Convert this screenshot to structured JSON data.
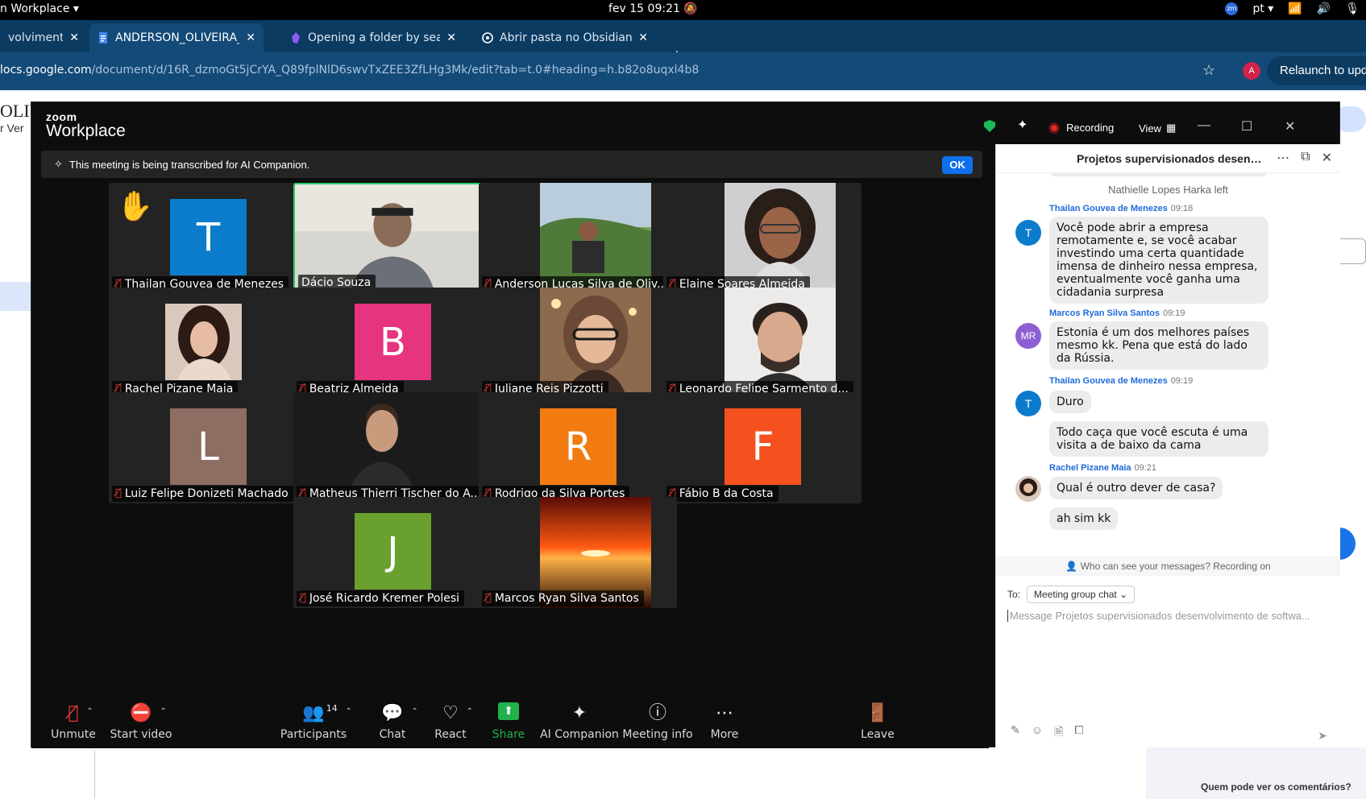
{
  "os": {
    "activities": "n Workplace ▾",
    "clock": "fev 15  09:21",
    "lang": "pt ▾",
    "zm": "zm"
  },
  "browser": {
    "tabs": [
      {
        "label": "volvimento",
        "active": false
      },
      {
        "label": "ANDERSON_OLIVEIRA_E",
        "active": true
      },
      {
        "label": "Opening a folder by sear",
        "active": false
      },
      {
        "label": "Abrir pasta no Obsidian",
        "active": false
      }
    ],
    "url_host": "locs.google.com",
    "url_path": "/document/d/16R_dzmoGt5jCrYA_Q89fplNlD6swvTxZEE3ZfLHg3Mk/edit?tab=t.0#heading=h.b82o8uqxl4b8",
    "profile_initial": "A",
    "relaunch": "Relaunch to upd"
  },
  "docs": {
    "title": "OLIV",
    "menu": "r  Ver",
    "bottom_text": "Quem pode ver os comentários?"
  },
  "zoom": {
    "logo_top": "zoom",
    "logo": "Workplace",
    "recording": "Recording",
    "view": "View",
    "banner": "This meeting is being transcribed for AI Companion.",
    "banner_ok": "OK",
    "tiles": [
      {
        "name": "Thailan Gouvea de Menezes",
        "initial": "T",
        "color": "#0b7ccc",
        "hand": true
      },
      {
        "name": "Dácio Souza",
        "photo": "man-headphones",
        "speaking": true
      },
      {
        "name": "Anderson Lucas Silva de Oliv...",
        "photo": "man-outdoor"
      },
      {
        "name": "Elaine Soares Almeida",
        "photo": "woman-glasses"
      },
      {
        "name": "Rachel Pizane Maia",
        "photo": "woman-dark"
      },
      {
        "name": "Beatriz Almeida",
        "initial": "B",
        "color": "#e6347f"
      },
      {
        "name": "Juliane Reis Pizzotti",
        "photo": "woman-glasses-2"
      },
      {
        "name": "Leonardo Felipe Sarmento d...",
        "photo": "man-beard"
      },
      {
        "name": "Luiz Felipe Donizeti Machado",
        "initial": "L",
        "color": "#8d6e63"
      },
      {
        "name": "Matheus Thierri Tischer do A...",
        "photo": "man-portrait"
      },
      {
        "name": "Rodrigo da Silva Portes",
        "initial": "R",
        "color": "#f27b12"
      },
      {
        "name": "Fábio B da Costa",
        "initial": "F",
        "color": "#f4511e"
      },
      {
        "name": "José Ricardo Kremer Polesi",
        "initial": "J",
        "color": "#6aa12e"
      },
      {
        "name": "Marcos Ryan Silva Santos",
        "photo": "sunset"
      }
    ],
    "toolbar": {
      "unmute": "Unmute",
      "start_video": "Start video",
      "participants": "Participants",
      "participants_count": "14",
      "chat": "Chat",
      "react": "React",
      "share": "Share",
      "ai": "AI Companion",
      "info": "Meeting info",
      "more": "More",
      "leave": "Leave"
    },
    "chat": {
      "title": "Projetos supervisionados desenv...",
      "left_notice": "Nathielle Lopes Harka left",
      "messages": [
        {
          "sender": "Thailan Gouvea de Menezes",
          "time": "09:18",
          "avatar": "T",
          "text": "Você pode abrir a empresa remotamente e, se você acabar investindo uma certa quantidade imensa de dinheiro nessa empresa, eventualmente você ganha uma cidadania surpresa"
        },
        {
          "sender": "Marcos Ryan Silva Santos",
          "time": "09:19",
          "avatar": "MR",
          "text": "Estonia é um dos melhores países mesmo kk. Pena que está do lado da Rússia."
        },
        {
          "sender": "Thailan Gouvea de Menezes",
          "time": "09:19",
          "avatar": "T",
          "text": "Duro",
          "text2": "Todo caça que você escuta é uma visita a de baixo da cama"
        },
        {
          "sender": "Rachel Pizane Maia",
          "time": "09:21",
          "avatar": "",
          "text": "Qual é outro dever de casa?",
          "text2": "ah sim kk"
        }
      ],
      "privacy": "Who can see your messages? Recording on",
      "to_label": "To:",
      "to_value": "Meeting group chat ⌄",
      "placeholder": "Message Projetos supervisionados desenvolvimento de softwa..."
    }
  }
}
